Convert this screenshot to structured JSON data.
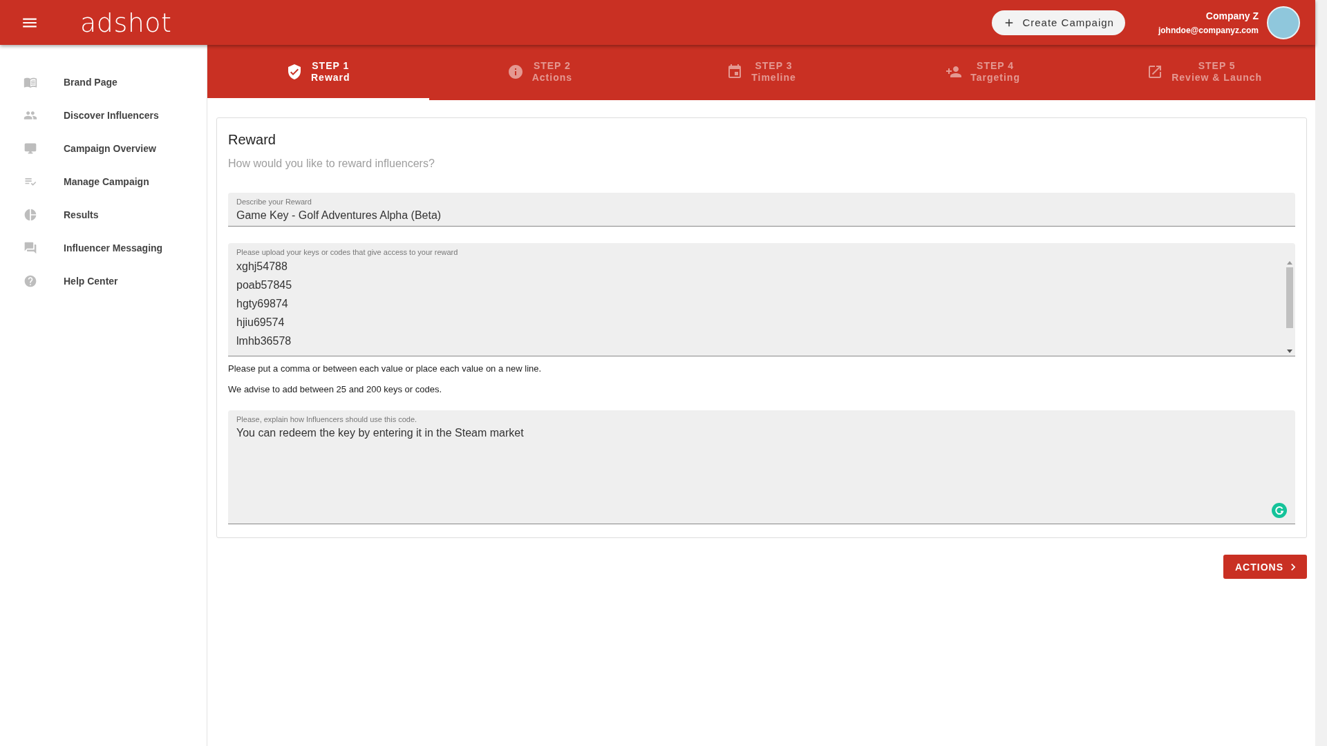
{
  "header": {
    "logo": "adshot",
    "create_button": "Create Campaign",
    "company": "Company Z",
    "email": "johndoe@companyz.com"
  },
  "sidebar": {
    "items": [
      {
        "label": "Brand Page",
        "selected": false
      },
      {
        "label": "Discover Influencers",
        "selected": false
      },
      {
        "label": "Campaign Overview",
        "selected": false
      },
      {
        "label": "Manage Campaign",
        "selected": false
      },
      {
        "label": "Results",
        "selected": false
      },
      {
        "label": "Influencer Messaging",
        "selected": false
      },
      {
        "label": "Help Center",
        "selected": false
      }
    ]
  },
  "steps": [
    {
      "step": "STEP 1",
      "label": "Reward",
      "selected": true
    },
    {
      "step": "STEP 2",
      "label": "Actions",
      "selected": false
    },
    {
      "step": "STEP 3",
      "label": "Timeline",
      "selected": false
    },
    {
      "step": "STEP 4",
      "label": "Targeting",
      "selected": false
    },
    {
      "step": "STEP 5",
      "label": "Review & Launch",
      "selected": false
    }
  ],
  "card": {
    "title": "Reward",
    "subtitle": "How would you like to reward influencers?",
    "reward_field": {
      "label": "Describe your Reward",
      "value": "Game Key - Golf Adventures Alpha (Beta)"
    },
    "keys_field": {
      "label": "Please upload your keys or codes that give access to your reward",
      "values": [
        "xghj54788",
        "poab57845",
        "hgty69874",
        "hjiu69574",
        "lmhb36578"
      ]
    },
    "hints": [
      "Please put a comma or between each value or place each value on a new line.",
      "We advise to add between 25 and 200 keys or codes."
    ],
    "usage_field": {
      "label": "Please, explain how Influencers should use this code.",
      "value": "You can redeem the key by entering it in the Steam market"
    }
  },
  "next_button": "ACTIONS"
}
